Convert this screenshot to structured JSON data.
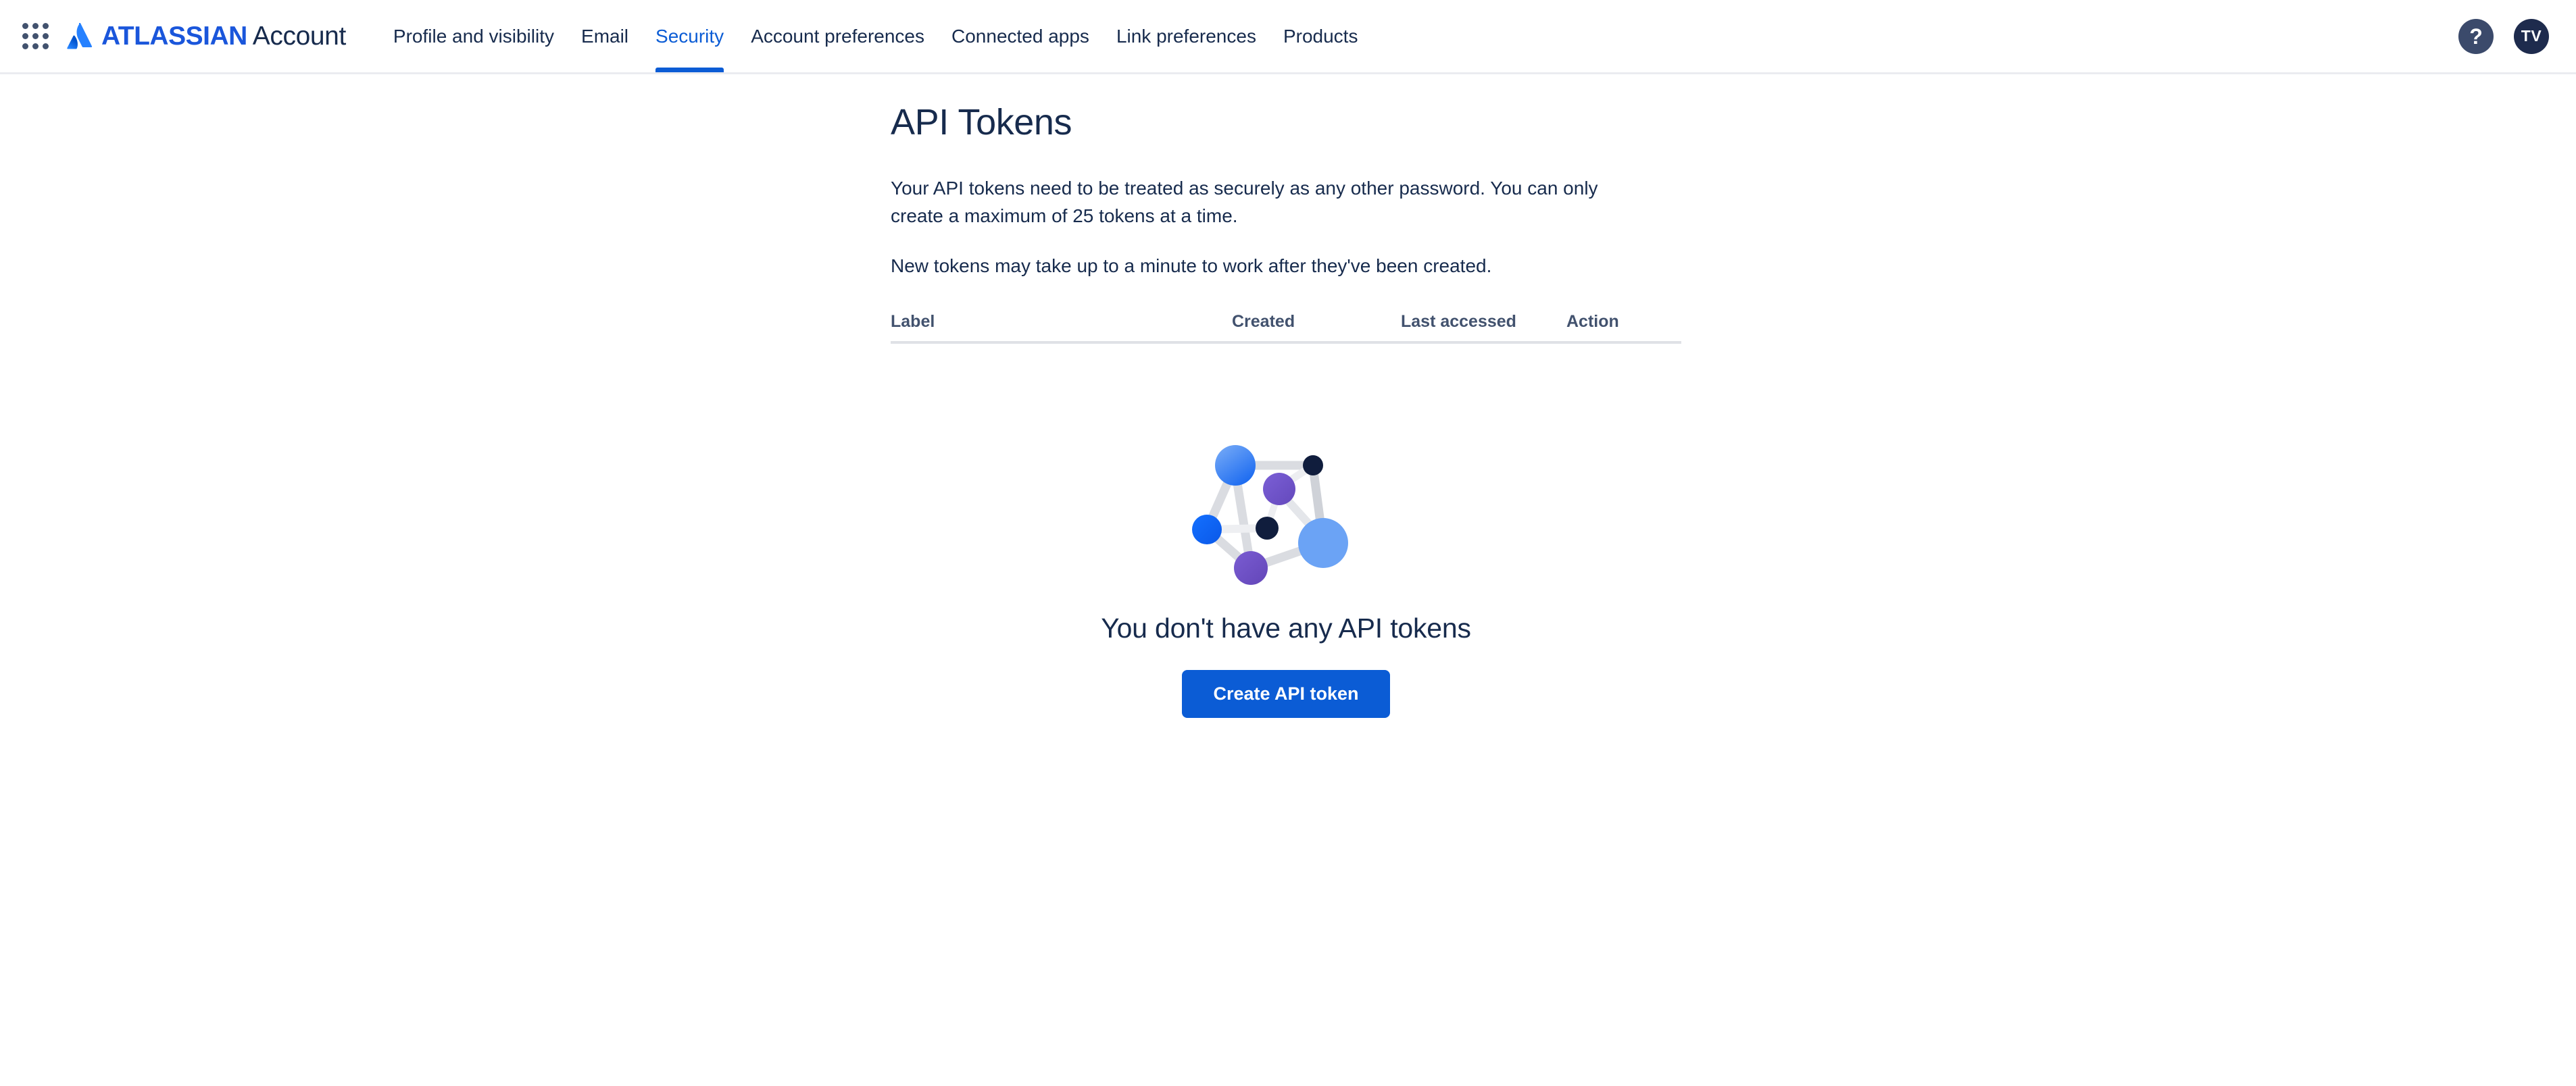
{
  "header": {
    "app_switcher_icon": "grid-apps-icon",
    "brand_logo_icon": "atlassian-logo-icon",
    "brand_name": "ATLASSIAN",
    "brand_product": "Account",
    "nav": [
      {
        "label": "Profile and visibility",
        "active": false
      },
      {
        "label": "Email",
        "active": false
      },
      {
        "label": "Security",
        "active": true
      },
      {
        "label": "Account preferences",
        "active": false
      },
      {
        "label": "Connected apps",
        "active": false
      },
      {
        "label": "Link preferences",
        "active": false
      },
      {
        "label": "Products",
        "active": false
      }
    ],
    "help_icon": "help-question-icon",
    "help_glyph": "?",
    "avatar_initials": "TV"
  },
  "main": {
    "title": "API Tokens",
    "paragraph_1": "Your API tokens need to be treated as securely as any other password. You can only create a maximum of 25 tokens at a time.",
    "paragraph_2": "New tokens may take up to a minute to work after they've been created.",
    "table": {
      "columns": [
        "Label",
        "Created",
        "Last accessed",
        "Action"
      ],
      "rows": []
    },
    "empty_state": {
      "illustration_icon": "network-nodes-illustration",
      "heading": "You don't have any API tokens",
      "create_button_label": "Create API token"
    }
  },
  "colors": {
    "accent_blue": "#0B5CD5",
    "brand_blue": "#1A56DB",
    "text_primary": "#172B4D",
    "text_muted": "#42526E",
    "divider": "#DFE1E6",
    "avatar_bg": "#1E2B4D",
    "help_bg": "#3B4A6B",
    "node_bright_blue": "#0065FF",
    "node_light_blue": "#6BA3F5",
    "node_navy": "#0B1437",
    "node_purple": "#6B4FC4",
    "node_edge": "#DCDEE3"
  }
}
